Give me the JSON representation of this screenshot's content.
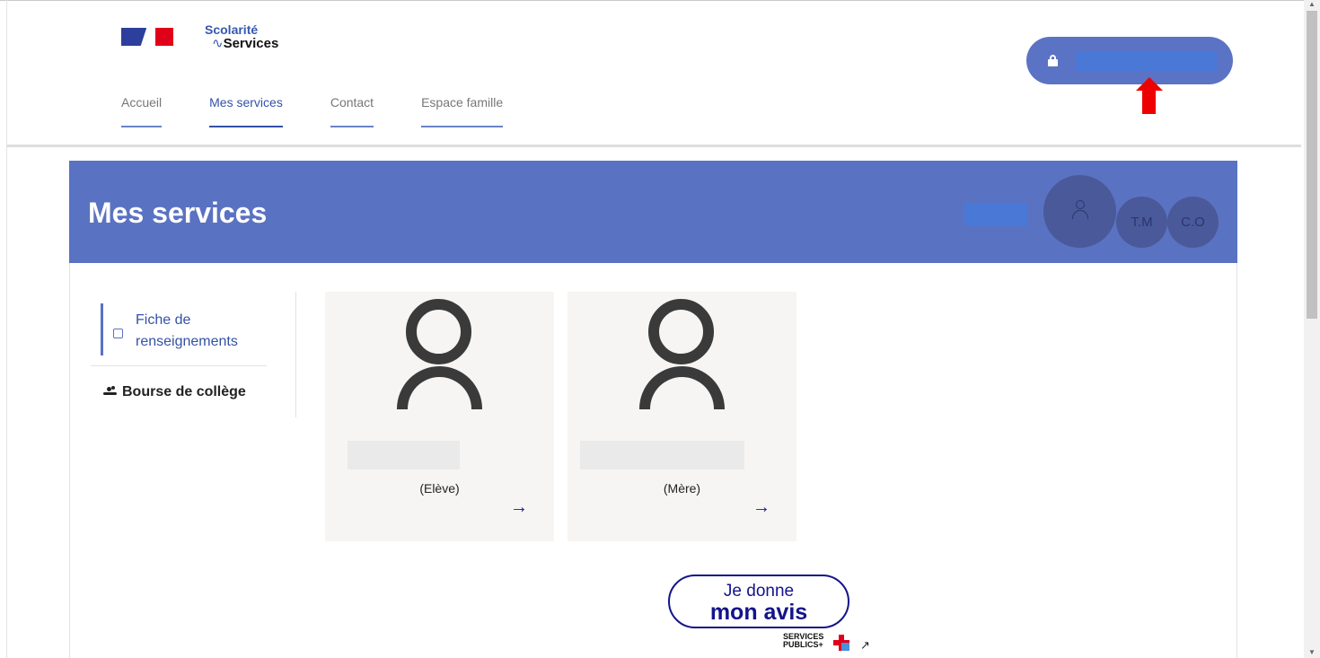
{
  "header": {
    "brand_line1": "Scolarité",
    "brand_line2": "Services",
    "nav": [
      {
        "label": "Accueil",
        "active": false
      },
      {
        "label": "Mes services",
        "active": true
      },
      {
        "label": "Contact",
        "active": false
      },
      {
        "label": "Espace famille",
        "active": false
      }
    ],
    "login_icon": "lock-icon"
  },
  "banner": {
    "title": "Mes services",
    "avatars": [
      "T.M",
      "C.O"
    ],
    "main_avatar_icon": "person-icon"
  },
  "sidebar": {
    "items": [
      {
        "label": "Fiche de renseignements",
        "icon": "edit-icon",
        "active": true
      },
      {
        "label": "Bourse de collège",
        "icon": "hand-coins-icon",
        "active": false
      }
    ]
  },
  "cards": [
    {
      "role": "(Elève)",
      "arrow": "→"
    },
    {
      "role": "(Mère)",
      "arrow": "→"
    }
  ],
  "feedback": {
    "line1": "Je donne",
    "line2": "mon avis",
    "brand": "SERVICES PUBLICS+"
  },
  "colors": {
    "primary": "#5a72c2",
    "dark_blue": "#14148a",
    "marianne_red": "#e1001a",
    "marianne_blue": "#2c3f9d",
    "annotation_arrow": "#ee0000"
  }
}
